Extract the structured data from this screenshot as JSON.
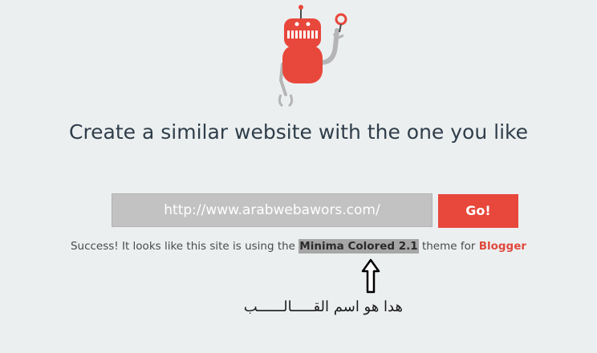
{
  "colors": {
    "background": "#eceff0",
    "robot_red": "#e8473b",
    "robot_arm": "#b5b5b5",
    "headline_text": "#2f3e4a",
    "input_bg": "#c2c2c2",
    "button_bg": "#e8473b",
    "theme_highlight": "#a6a6a6",
    "link_red": "#e0493d"
  },
  "hero": {
    "icon": "robot-icon",
    "headline": "Create a similar website with the one you like"
  },
  "search": {
    "url_value": "http://www.arabwebawors.com/",
    "go_label": "Go!"
  },
  "result": {
    "prefix": "Success! It looks like this site is using the",
    "theme_name": "Minima Colored 2.1",
    "middle": "theme for",
    "platform": "Blogger"
  },
  "annotation": {
    "arrow_icon": "up-arrow-icon",
    "text": "هدا هو اسم القـــــالــــــب"
  }
}
